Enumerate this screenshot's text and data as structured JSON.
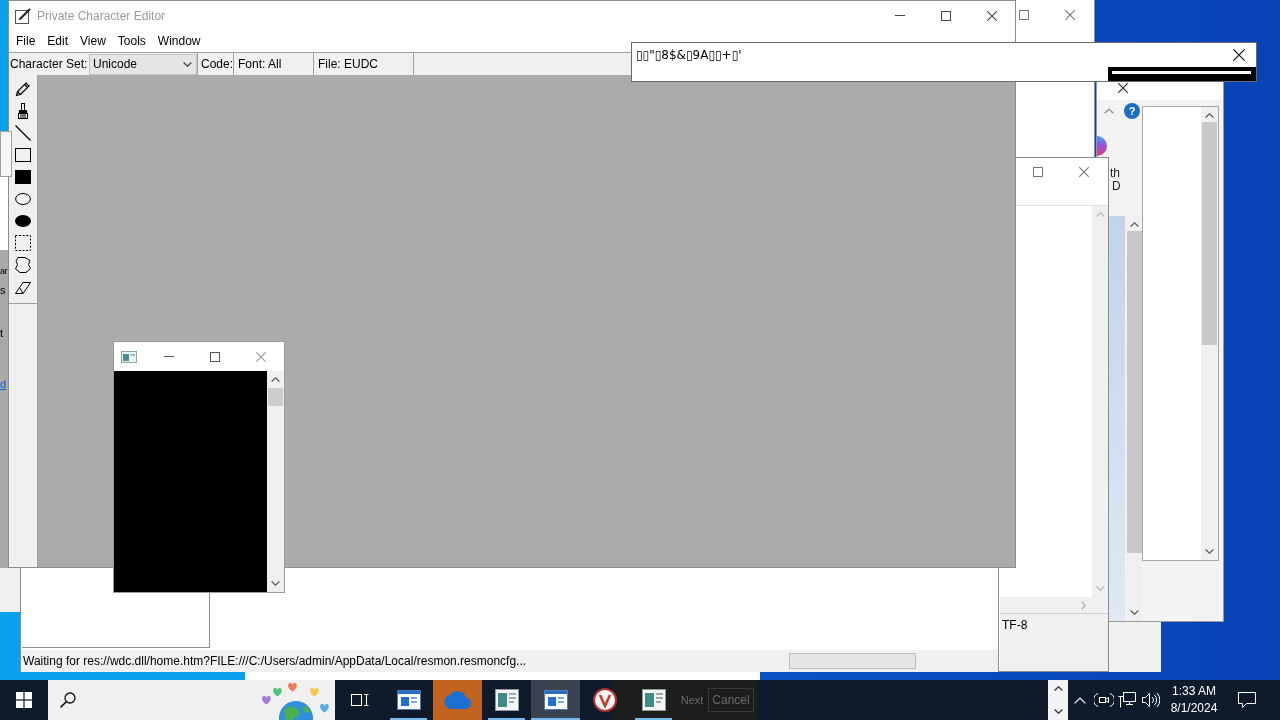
{
  "main_window": {
    "title": "Private Character Editor",
    "menu": [
      "File",
      "Edit",
      "View",
      "Tools",
      "Window"
    ],
    "character_set": {
      "label": "Character Set:",
      "value": "Unicode"
    },
    "code_label": "Code:",
    "font_label": "Font: All",
    "file_label": "File: EUDC",
    "tools": [
      {
        "kind": "pencil"
      },
      {
        "kind": "brush"
      },
      {
        "kind": "line"
      },
      {
        "kind": "rectangle"
      },
      {
        "kind": "filled_rectangle"
      },
      {
        "kind": "ellipse"
      },
      {
        "kind": "filled_ellipse"
      },
      {
        "kind": "rect_select"
      },
      {
        "kind": "freeform_select"
      },
      {
        "kind": "eraser"
      }
    ]
  },
  "popup_window": {
    "text": "▯▯\"▯8$&▯9A▯▯+▯'"
  },
  "status_bar": {
    "text": "Waiting for res://wdc.dll/home.htm?FILE:///C:/Users/admin/AppData/Local/resmon.resmoncfg..."
  },
  "left_edge_window": {
    "texts": [
      "ar",
      "s",
      "t"
    ],
    "link": "d"
  },
  "help_window": {
    "help_label": "?",
    "texts": [
      "th",
      "D"
    ]
  },
  "side_window": {
    "status_text": "TF-8"
  },
  "ghost_dialog": {
    "buttons": [
      "Next",
      "Cancel"
    ]
  },
  "taskbar": {
    "apps": [
      {
        "kind": "window",
        "selected": false,
        "running": true,
        "flashing": false
      },
      {
        "kind": "cloud",
        "selected": false,
        "running": false,
        "flashing": true
      },
      {
        "kind": "sheet",
        "selected": false,
        "running": true,
        "flashing": false
      },
      {
        "kind": "window",
        "selected": true,
        "running": true,
        "flashing": false
      },
      {
        "kind": "badge",
        "selected": false,
        "running": false,
        "flashing": false
      },
      {
        "kind": "sheet",
        "selected": false,
        "running": true,
        "flashing": false
      }
    ],
    "clock": {
      "time": "1:33 AM",
      "date": "8/1/2024"
    }
  }
}
